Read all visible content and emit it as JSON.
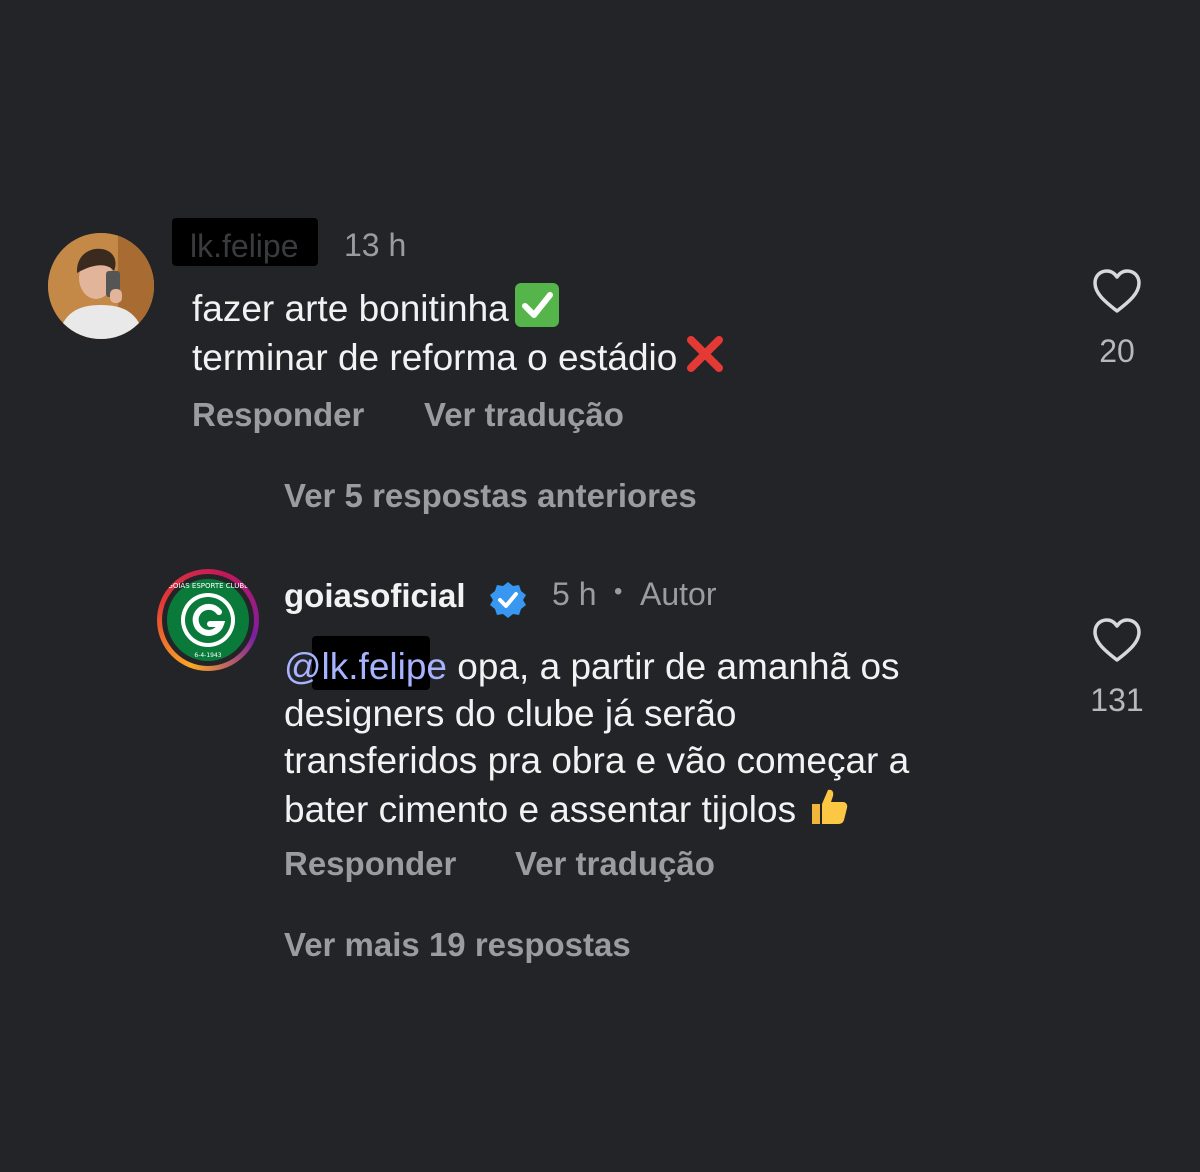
{
  "comment1": {
    "username": "lk.felipe",
    "time": "13 h",
    "line1": "fazer arte bonitinha",
    "line2": "terminar de reforma o estádio",
    "like_count": "20",
    "reply_label": "Responder",
    "translate_label": "Ver tradução"
  },
  "thread": {
    "previous_replies": "Ver 5 respostas anteriores",
    "more_replies": "Ver mais 19 respostas"
  },
  "comment2": {
    "username": "goiasoficial",
    "time": "5 h",
    "separator": "•",
    "author_tag": "Autor",
    "mention": "@lk.felipe",
    "line1": "opa, a partir de amanhã os",
    "line2": "designers do clube já serão",
    "line3": "transferidos pra obra e vão começar a",
    "line4": "bater cimento e assentar tijolos",
    "like_count": "131",
    "reply_label": "Responder",
    "translate_label": "Ver tradução",
    "avatar_ring_text": "GOIÁS ESPORTE CLUBE",
    "avatar_date": "6-4-1943"
  },
  "colors": {
    "background": "#232427",
    "primary_text": "#f2f2f2",
    "secondary_text": "#9b9ca0",
    "mention": "#a8b3ff",
    "verified": "#3897f0",
    "club_green": "#0a7a3b"
  }
}
